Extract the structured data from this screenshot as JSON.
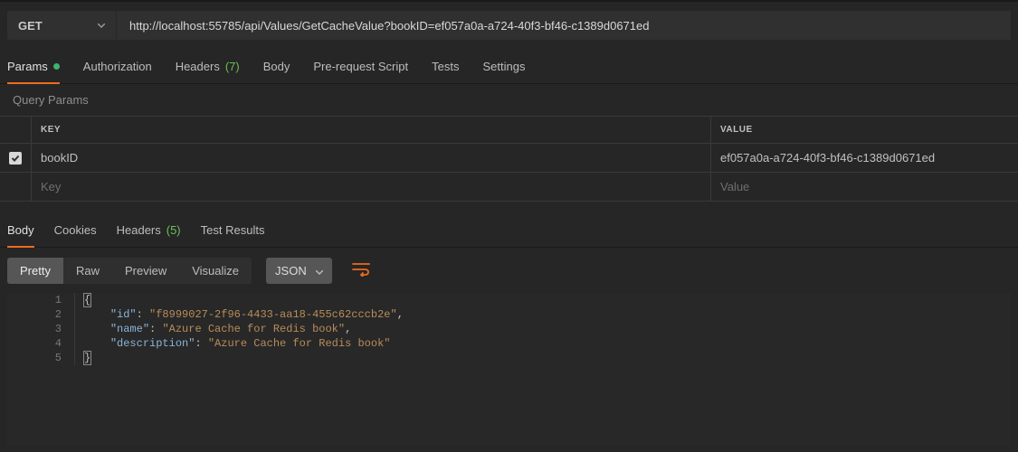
{
  "request": {
    "method": "GET",
    "url": "http://localhost:55785/api/Values/GetCacheValue?bookID=ef057a0a-a724-40f3-bf46-c1389d0671ed"
  },
  "request_tabs": {
    "params": "Params",
    "authorization": "Authorization",
    "headers": "Headers",
    "headers_count": "(7)",
    "body": "Body",
    "prerequest": "Pre-request Script",
    "tests": "Tests",
    "settings": "Settings"
  },
  "query_params": {
    "section_label": "Query Params",
    "header_key": "KEY",
    "header_value": "VALUE",
    "rows": [
      {
        "checked": true,
        "key": "bookID",
        "value": "ef057a0a-a724-40f3-bf46-c1389d0671ed"
      }
    ],
    "placeholder_key": "Key",
    "placeholder_value": "Value"
  },
  "response_tabs": {
    "body": "Body",
    "cookies": "Cookies",
    "headers": "Headers",
    "headers_count": "(5)",
    "test_results": "Test Results"
  },
  "body_toolbar": {
    "pretty": "Pretty",
    "raw": "Raw",
    "preview": "Preview",
    "visualize": "Visualize",
    "language": "JSON"
  },
  "response_json": {
    "id": "f8999027-2f96-4433-aa18-455c62cccb2e",
    "name": "Azure Cache for Redis book",
    "description": "Azure Cache for Redis book"
  }
}
